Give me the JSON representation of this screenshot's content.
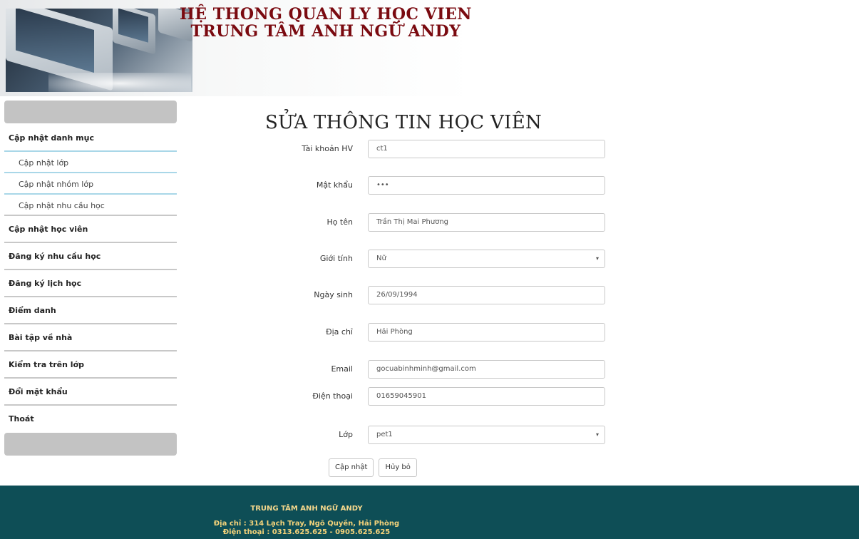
{
  "header": {
    "title_line1": "HỆ THONG QUAN LY HỌC VIEN",
    "title_line2": "TRUNG TÂM ANH NGỮ ANDY"
  },
  "sidebar": {
    "items": [
      {
        "label": "Cập nhật danh mục"
      },
      {
        "label": "Cập nhật lớp"
      },
      {
        "label": "Cập nhật nhóm lớp"
      },
      {
        "label": "Cập nhật nhu cầu học"
      },
      {
        "label": "Cập nhật học viên"
      },
      {
        "label": "Đăng ký nhu cầu học"
      },
      {
        "label": "Đăng ký lịch học"
      },
      {
        "label": "Điểm danh"
      },
      {
        "label": "Bài tập về nhà"
      },
      {
        "label": "Kiểm tra trên lớp"
      },
      {
        "label": "Đổi mật khẩu"
      },
      {
        "label": "Thoát"
      }
    ]
  },
  "form": {
    "title": "SỬA THÔNG TIN HỌC VIÊN",
    "fields": [
      {
        "label": "Tài khoản HV",
        "value": "ct1"
      },
      {
        "label": "Mật khẩu",
        "value": "•••"
      },
      {
        "label": "Họ tên",
        "value": "Trần Thị Mai Phương"
      },
      {
        "label": "Giới tính",
        "value": "Nữ"
      },
      {
        "label": "Ngày sinh",
        "value": "26/09/1994"
      },
      {
        "label": "Địa chỉ",
        "value": "Hải Phòng"
      },
      {
        "label": "Email",
        "value": "gocuabinhminh@gmail.com"
      },
      {
        "label": "Điện thoại",
        "value": "01659045901"
      },
      {
        "label": "Lớp",
        "value": "pet1"
      }
    ],
    "update_label": "Cập nhật",
    "cancel_label": "Hủy bỏ"
  },
  "footer": {
    "name": "TRUNG TÂM ANH NGỮ ANDY",
    "address": "Địa chỉ : 314 Lạch Tray, Ngô Quyền, Hải Phòng",
    "phone": "Điện thoại : 0313.625.625 - 0905.625.625"
  },
  "colors": {
    "title": "#7a0a10",
    "footer_bg": "#0e4e56",
    "footer_text": "#f3d27a",
    "menu_accent": "#a9d7e8"
  }
}
